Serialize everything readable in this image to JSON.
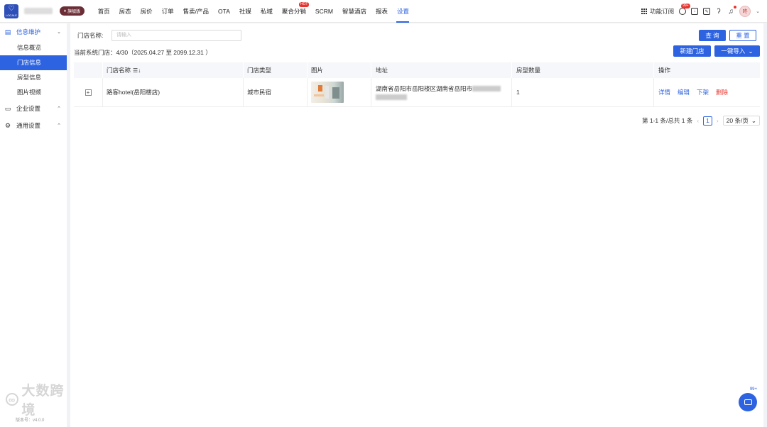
{
  "topbar": {
    "logo_text": "LOCALE",
    "edition_badge": "旗舰版",
    "nav": [
      {
        "label": "首页"
      },
      {
        "label": "房态"
      },
      {
        "label": "房价"
      },
      {
        "label": "订单"
      },
      {
        "label": "售卖/产品"
      },
      {
        "label": "OTA"
      },
      {
        "label": "社媒"
      },
      {
        "label": "私域"
      },
      {
        "label": "聚合分销",
        "badge": "HOT"
      },
      {
        "label": "SCRM"
      },
      {
        "label": "智慧酒店"
      },
      {
        "label": "报表"
      },
      {
        "label": "设置",
        "active": true
      }
    ],
    "subscribe_label": "功能订阅",
    "message_badge": "99+",
    "avatar_text": "咚"
  },
  "sidebar": {
    "groups": [
      {
        "label": "信息维护",
        "icon": "info-doc-icon",
        "open": true,
        "items": [
          {
            "label": "信息概览"
          },
          {
            "label": "门店信息",
            "active": true
          },
          {
            "label": "房型信息"
          },
          {
            "label": "图片视频"
          }
        ]
      },
      {
        "label": "企业设置",
        "icon": "enterprise-icon",
        "open": false
      },
      {
        "label": "通用设置",
        "icon": "gear-icon",
        "open": false
      }
    ],
    "version": "版本号：v4.0.0",
    "watermark_text": "大数跨境"
  },
  "filter": {
    "label": "门店名称:",
    "placeholder": "请输入",
    "query_label": "查 询",
    "reset_label": "重 置"
  },
  "store_count": "当前系统门店：4/30（2025.04.27 至 2099.12.31 ）",
  "actions": {
    "new_store_label": "新建门店",
    "import_label": "一键导入"
  },
  "table": {
    "columns": [
      "门店名称",
      "门店类型",
      "图片",
      "地址",
      "房型数量",
      "操作"
    ],
    "rows": [
      {
        "name": "路客hotel(岳阳楼店)",
        "type": "城市民宿",
        "address": "湖南省岳阳市岳阳楼区湖南省岳阳市",
        "room_count": "1",
        "ops": [
          "详情",
          "编辑",
          "下架",
          "删除"
        ]
      }
    ]
  },
  "pagination": {
    "summary": "第 1-1 条/总共 1 条",
    "current_page": "1",
    "page_size": "20 条/页"
  },
  "chat_badge": "99+",
  "colors": {
    "primary": "#2d63e0",
    "danger": "#e8342e",
    "edition": "#6b2e36"
  }
}
